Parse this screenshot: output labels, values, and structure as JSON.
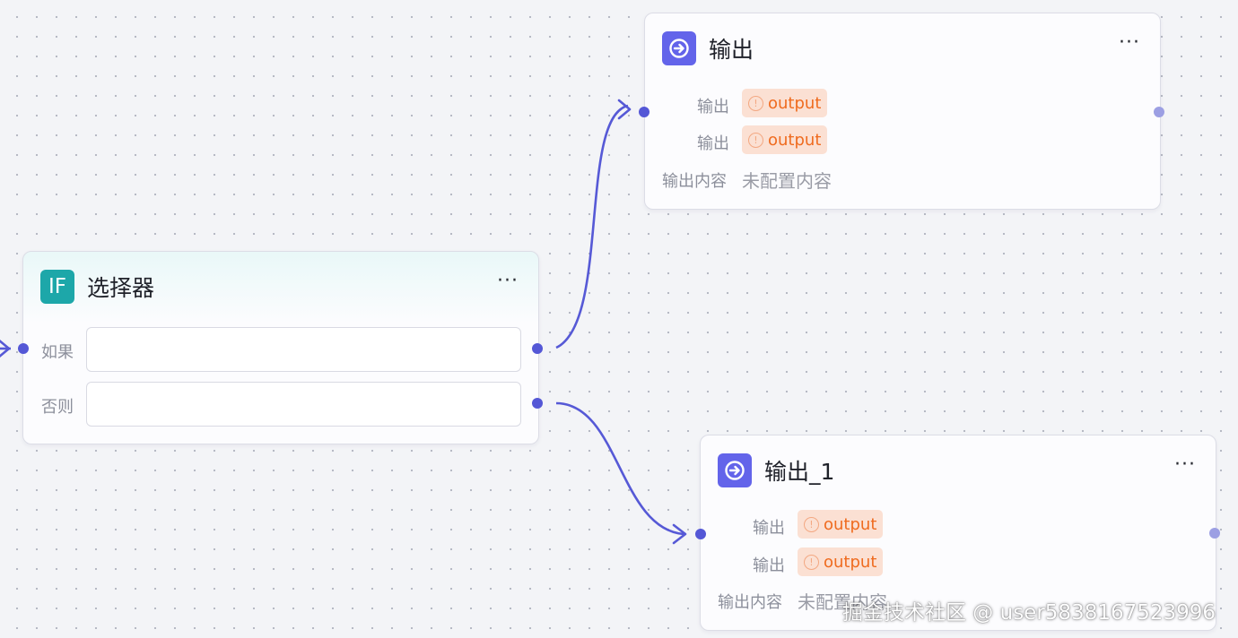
{
  "canvas": {
    "edge_color": "#5659d6",
    "grid": "dotted"
  },
  "selector_node": {
    "icon": "if-icon",
    "icon_text": "IF",
    "title": "选择器",
    "more": "···",
    "rows": [
      {
        "label": "如果",
        "value": ""
      },
      {
        "label": "否则",
        "value": ""
      }
    ],
    "accent": "#1da7a9"
  },
  "output_node_a": {
    "icon": "arrow-circle-right-icon",
    "title": "输出",
    "more": "···",
    "params": [
      {
        "label": "输出",
        "value": "output"
      },
      {
        "label": "输出",
        "value": "output"
      }
    ],
    "content_label": "输出内容",
    "content_value": "未配置内容",
    "accent": "#6364ea"
  },
  "output_node_b": {
    "icon": "arrow-circle-right-icon",
    "title": "输出_1",
    "more": "···",
    "params": [
      {
        "label": "输出",
        "value": "output"
      },
      {
        "label": "输出",
        "value": "output"
      }
    ],
    "content_label": "输出内容",
    "content_value": "未配置内容",
    "accent": "#6364ea"
  },
  "watermark": "掘金技术社区 @ user5838167523996"
}
